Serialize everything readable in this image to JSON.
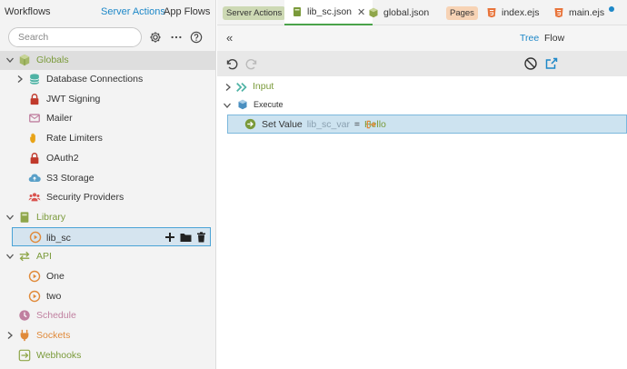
{
  "left_tabs": {
    "workflows": "Workflows",
    "server_actions": "Server Actions",
    "app_flows": "App Flows"
  },
  "search": {
    "placeholder": "Search"
  },
  "tree": {
    "globals": "Globals",
    "globals_items": [
      "Database Connections",
      "JWT Signing",
      "Mailer",
      "Rate Limiters",
      "OAuth2",
      "S3 Storage",
      "Security Providers"
    ],
    "library": "Library",
    "library_items": [
      "lib_sc"
    ],
    "api": "API",
    "api_items": [
      "One",
      "two"
    ],
    "schedule": "Schedule",
    "sockets": "Sockets",
    "webhooks": "Webhooks"
  },
  "file_tabs": {
    "server_actions_tag": "Server Actions",
    "lib_sc_json": "lib_sc.json",
    "global_json": "global.json",
    "pages_tag": "Pages",
    "index_ejs": "index.ejs",
    "main_ejs": "main.ejs"
  },
  "view_tabs": {
    "tree": "Tree",
    "flow": "Flow"
  },
  "steps": {
    "input": "Input",
    "execute": "Execute",
    "set_value": {
      "label": "Set Value",
      "var": "lib_sc_var",
      "eq": "=",
      "value": "Hello"
    }
  },
  "colors": {
    "accent": "#1e88c8",
    "green": "#7a9a3a",
    "orange": "#e08a3a",
    "pink": "#c080a0"
  }
}
